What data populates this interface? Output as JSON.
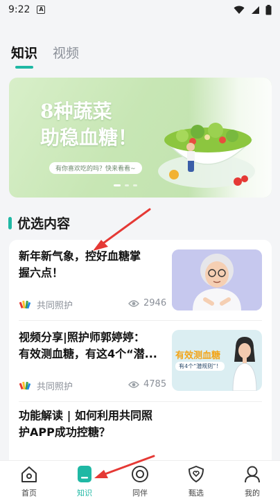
{
  "status_bar": {
    "time": "9:22",
    "app_icon": "A"
  },
  "tabs": [
    {
      "label": "知识",
      "active": true
    },
    {
      "label": "视频",
      "active": false
    }
  ],
  "banner": {
    "title_line1": "8种蔬菜",
    "title_line2": "助稳血糖！",
    "pill_text": "有你喜欢吃的吗？快来看看~"
  },
  "section": {
    "title": "优选内容"
  },
  "articles": [
    {
      "title": "新年新气象，控好血糖掌握六点！",
      "title_line1": "新年新气象，控好血糖掌",
      "title_line2": "握六点！",
      "source": "共同照护",
      "views": "2946"
    },
    {
      "title_line1": "视频分享|照护师郭婷婷：",
      "title_line2": "有效测血糖，有这4个“潜...",
      "source": "共同照护",
      "views": "4785",
      "thumb_text1": "有效测血糖",
      "thumb_text2": "有4个“潜规则”！"
    },
    {
      "title_line1": "功能解读 | 如何利用共同照",
      "title_line2": "护APP成功控糖？"
    }
  ],
  "nav": [
    {
      "label": "首页",
      "icon": "home-icon",
      "active": false
    },
    {
      "label": "知识",
      "icon": "book-icon",
      "active": true
    },
    {
      "label": "同伴",
      "icon": "circle-icon",
      "active": false
    },
    {
      "label": "甄选",
      "icon": "heart-shield-icon",
      "active": false
    },
    {
      "label": "我的",
      "icon": "user-icon",
      "active": false
    }
  ],
  "colors": {
    "accent": "#1fb8a4",
    "annotation_arrow": "#e53935"
  }
}
